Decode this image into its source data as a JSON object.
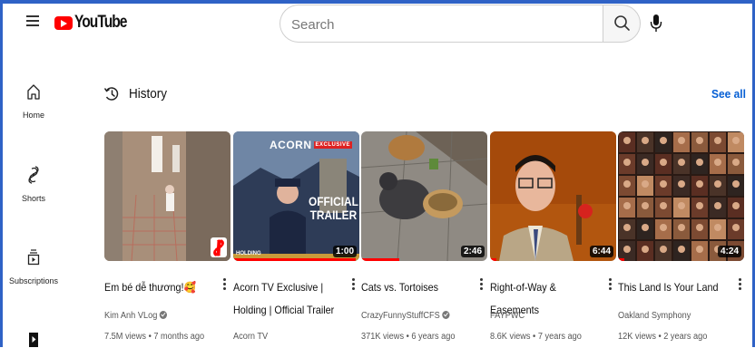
{
  "app": {
    "logo_text": "YouTube"
  },
  "search": {
    "placeholder": "Search",
    "value": ""
  },
  "sidebar": {
    "items": [
      {
        "label": "Home",
        "icon": "home-icon"
      },
      {
        "label": "Shorts",
        "icon": "shorts-icon"
      },
      {
        "label": "Subscriptions",
        "icon": "subscriptions-icon"
      },
      {
        "label": "",
        "icon": "library-icon"
      }
    ]
  },
  "history": {
    "title": "History",
    "see_all": "See all",
    "videos": [
      {
        "title": "Em bé dễ thương!🥰",
        "channel": "Kim Anh VLog",
        "verified": true,
        "meta": "7.5M views • 7 months ago",
        "duration": "",
        "badge": "shorts-badge-icon",
        "progress": 0
      },
      {
        "title": "Acorn TV Exclusive | Holding | Official Trailer",
        "channel": "Acorn TV",
        "verified": false,
        "meta": "",
        "duration": "1:00",
        "thumb_text": {
          "brand": "ACORN",
          "tag": "EXCLUSIVE",
          "big1": "OFFICIAL",
          "big2": "TRAILER",
          "small": "HOLDING"
        },
        "progress": 0.97
      },
      {
        "title": "Cats vs. Tortoises",
        "channel": "CrazyFunnyStuffCFS",
        "verified": true,
        "meta": "371K views • 6 years ago",
        "duration": "2:46",
        "progress": 0.3
      },
      {
        "title": "Right-of-Way & Easements",
        "channel": "FAYPWC",
        "verified": false,
        "meta": "8.6K views • 7 years ago",
        "duration": "6:44",
        "progress": 0.05
      },
      {
        "title": "This Land Is Your Land",
        "channel": "Oakland Symphony",
        "verified": false,
        "meta": "12K views • 2 years ago",
        "duration": "4:24",
        "progress": 0.05
      }
    ]
  },
  "colors": {
    "accent": "#ff0000",
    "link": "#065fd4",
    "frame": "#2f62c6"
  }
}
